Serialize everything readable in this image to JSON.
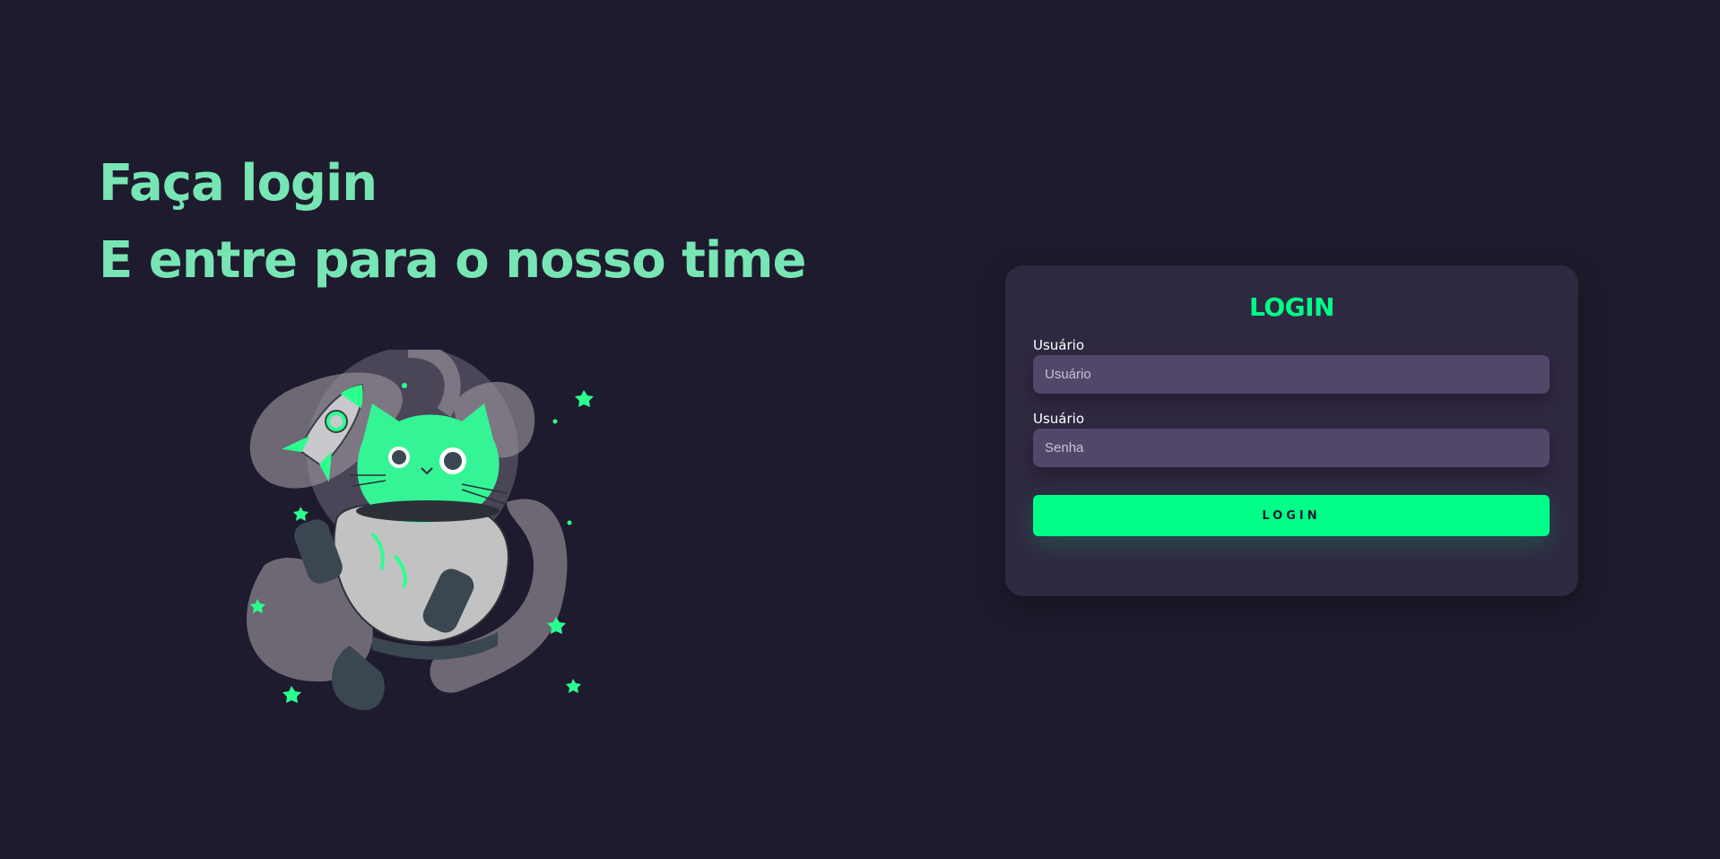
{
  "hero": {
    "line1": "Faça login",
    "line2": "E entre para o nosso time"
  },
  "illustration": {
    "icon": "astronaut-cat-illustration"
  },
  "login_card": {
    "title": "LOGIN",
    "username_label": "Usuário",
    "username_placeholder": "Usuário",
    "password_label": "Usuário",
    "password_placeholder": "Senha",
    "button_label": "LOGIN"
  },
  "colors": {
    "background": "#1f1b2e",
    "card": "#2f2841",
    "input": "#514869",
    "accent": "#00ff88",
    "hero_text": "#77e6b4"
  }
}
